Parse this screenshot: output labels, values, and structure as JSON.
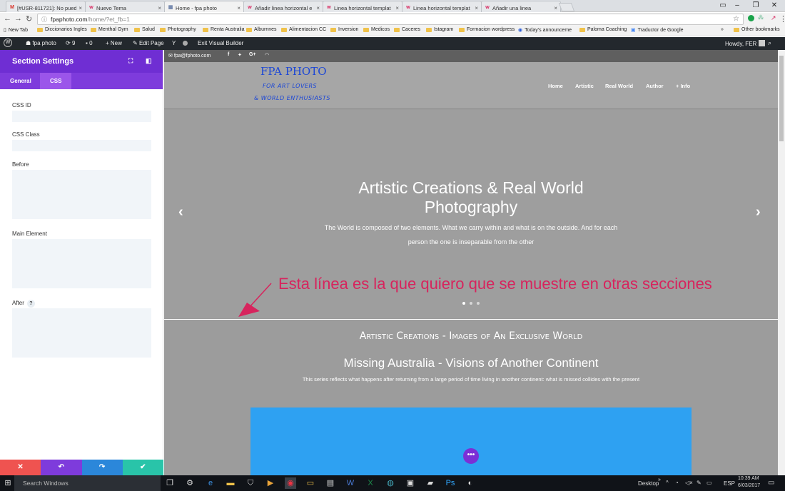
{
  "browser": {
    "tabs": [
      {
        "icon": "M",
        "icon_color": "#d93025",
        "title": "[#USR-811721]: No pued",
        "active": false
      },
      {
        "icon": "w",
        "icon_color": "#d7245d",
        "title": "Nuevo Tema",
        "active": false
      },
      {
        "icon": "▦",
        "icon_color": "#6a7fa8",
        "title": "Home - fpa photo",
        "active": true
      },
      {
        "icon": "w",
        "icon_color": "#d7245d",
        "title": "Añadir linea horizontal e",
        "active": false
      },
      {
        "icon": "w",
        "icon_color": "#d7245d",
        "title": "Linea horizontal templat",
        "active": false
      },
      {
        "icon": "w",
        "icon_color": "#d7245d",
        "title": "Linea horizontal templat",
        "active": false
      },
      {
        "icon": "w",
        "icon_color": "#d7245d",
        "title": "Añadir una linea",
        "active": false
      }
    ],
    "close_glyph": "×",
    "url_host": "fpaphoto.com",
    "url_path": "/home/?et_fb=1",
    "window_controls": {
      "minimize": "–",
      "restore": "❐",
      "close": "✕"
    },
    "bookmarks": [
      {
        "label": "New Tab",
        "icon": "page"
      },
      {
        "label": "Diccionarios Ingles",
        "icon": "folder"
      },
      {
        "label": "Menthal Gym",
        "icon": "folder"
      },
      {
        "label": "Salud",
        "icon": "folder"
      },
      {
        "label": "Photography",
        "icon": "folder"
      },
      {
        "label": "Renta Australia",
        "icon": "folder"
      },
      {
        "label": "Alburnnes",
        "icon": "folder"
      },
      {
        "label": "Alimentacion CC",
        "icon": "folder"
      },
      {
        "label": "Inversion",
        "icon": "folder"
      },
      {
        "label": "Medicos",
        "icon": "folder"
      },
      {
        "label": "Caceres",
        "icon": "folder"
      },
      {
        "label": "Istagram",
        "icon": "folder"
      },
      {
        "label": "Formacion wordpress",
        "icon": "folder"
      },
      {
        "label": "Today's announceme",
        "icon": "globe"
      },
      {
        "label": "Paloma Coaching",
        "icon": "folder"
      },
      {
        "label": "Traductor de Google",
        "icon": "translate"
      }
    ],
    "bookmarks_overflow": "»",
    "other_bookmarks": "Other bookmarks"
  },
  "wp_admin": {
    "site_name": "fpa photo",
    "updates_count": "9",
    "comments_count": "0",
    "new_label": "New",
    "edit_label": "Edit Page",
    "exit_label": "Exit Visual Builder",
    "howdy": "Howdy, FER"
  },
  "panel": {
    "title": "Section Settings",
    "tabs": [
      "General",
      "CSS"
    ],
    "active_tab": "CSS",
    "fields": {
      "css_id": "CSS ID",
      "css_class": "CSS Class",
      "before": "Before",
      "main_element": "Main Element",
      "after": "After"
    },
    "help_glyph": "?",
    "footer_buttons": [
      {
        "name": "discard",
        "glyph": "✕",
        "color": "#ef5350"
      },
      {
        "name": "undo",
        "glyph": "↶",
        "color": "#7e3bdc"
      },
      {
        "name": "redo",
        "glyph": "↷",
        "color": "#2b87da"
      },
      {
        "name": "save",
        "glyph": "✔",
        "color": "#29c4a9"
      }
    ]
  },
  "site": {
    "email": "fpa@fphoto.com",
    "logo_title": "FPA PHOTO",
    "logo_line1": "FOR ART LOVERS",
    "logo_line2": "& WORLD ENTHUSIASTS",
    "nav": [
      "Home",
      "Artistic",
      "Real World",
      "Author",
      "+ Info"
    ],
    "hero_title_1": "Artistic Creations & Real World",
    "hero_title_2": "Photography",
    "hero_body_1": "The World is composed of two elements. What we carry within and what is on the outside. And for each",
    "hero_body_2": "person the one is inseparable from the other",
    "annotation": "Esta línea es la que quiero que se muestre en otras secciones",
    "annotation_color": "#d7245d",
    "section_title": "Artistic Creations - Images of An Exclusive World",
    "section_subtitle": "Missing Australia - Visions of Another Continent",
    "section_body": "This series reflects what happens after returning from a large period of time living in another continent: what is missed collides with the present",
    "box_color": "#2ea1f2",
    "slider_dots": 3
  },
  "taskbar": {
    "search_placeholder": "Search Windows",
    "desktop_label": "Desktop",
    "lang": "ESP",
    "time": "10:39 AM",
    "date": "6/03/2017"
  }
}
